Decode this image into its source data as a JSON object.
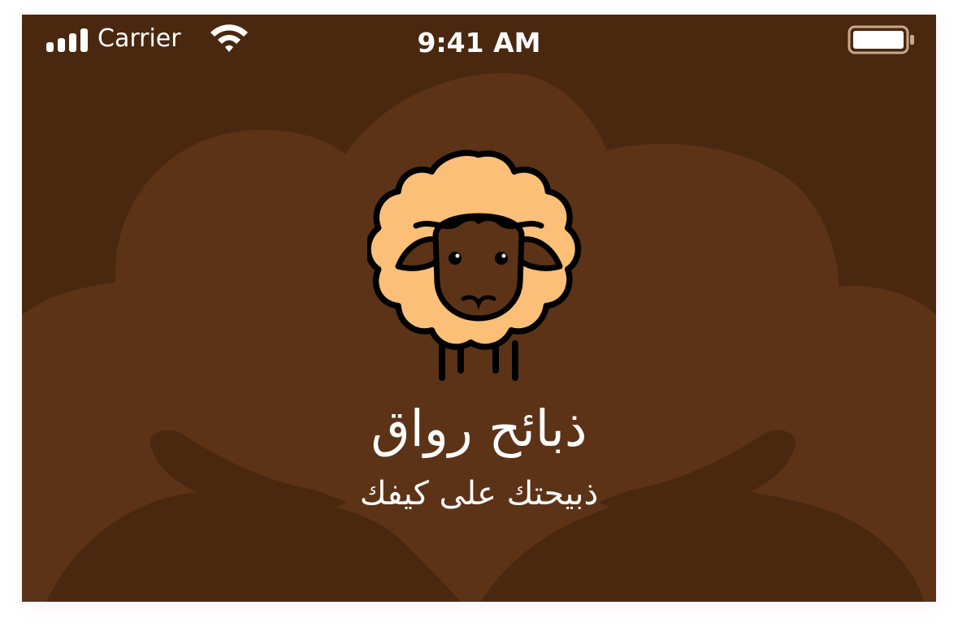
{
  "status_bar": {
    "carrier": "Carrier",
    "time": "9:41 AM",
    "signal_icon": "cellular-signal-icon",
    "wifi_icon": "wifi-icon",
    "battery_icon": "battery-icon"
  },
  "splash": {
    "logo_icon": "sheep-icon",
    "title": "ذبائح رواق",
    "tagline": "ذبيحتك على كيفك"
  },
  "colors": {
    "background": "#4a2810",
    "background_shape": "#5c3317",
    "sheep_wool": "#fcbf78",
    "sheep_face": "#5c3317",
    "outline": "#000000",
    "text": "#ffffff"
  }
}
